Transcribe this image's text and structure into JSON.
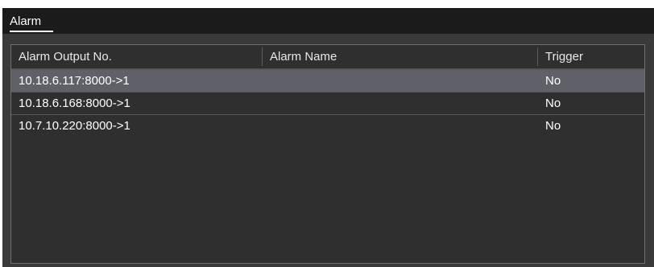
{
  "window": {
    "title": "Alarm"
  },
  "table": {
    "headers": {
      "output_no": "Alarm Output No.",
      "name": "Alarm Name",
      "trigger": "Trigger"
    },
    "rows": [
      {
        "output_no": "10.18.6.117:8000->1",
        "name": "",
        "trigger": "No",
        "selected": true
      },
      {
        "output_no": "10.18.6.168:8000->1",
        "name": "",
        "trigger": "No",
        "selected": false
      },
      {
        "output_no": "10.7.10.220:8000->1",
        "name": "",
        "trigger": "No",
        "selected": false
      }
    ]
  },
  "colors": {
    "panel_background": "#3a3a3a",
    "title_bar_background": "#1b1b1b",
    "selected_row_background": "#5f6168",
    "text": "#ffffff"
  }
}
